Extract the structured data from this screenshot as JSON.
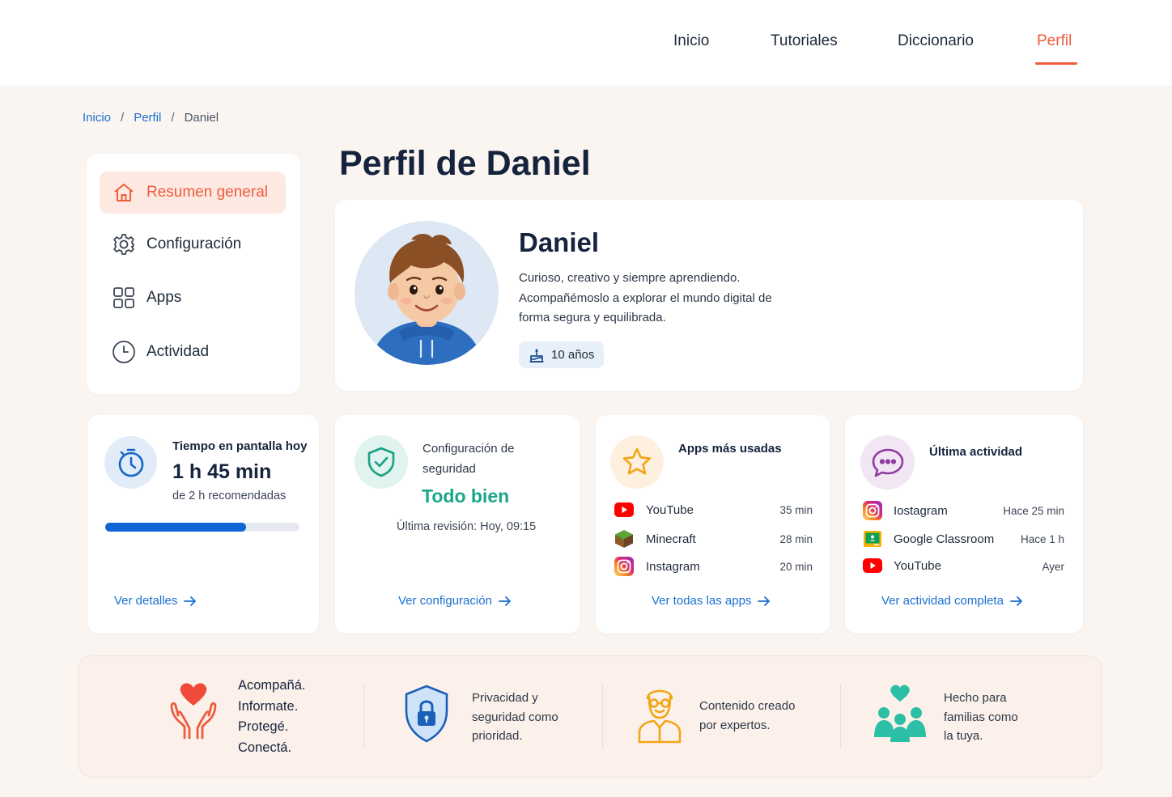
{
  "nav": {
    "items": [
      "Inicio",
      "Tutoriales",
      "Diccionario",
      "Perfil"
    ],
    "active": "Perfil"
  },
  "breadcrumb": [
    "Inicio",
    "Perfil",
    "Daniel"
  ],
  "sidebar": {
    "items": [
      {
        "label": "Resumen general",
        "icon": "home-icon",
        "active": true
      },
      {
        "label": "Configuración",
        "icon": "gear-icon"
      },
      {
        "label": "Apps",
        "icon": "grid-icon"
      },
      {
        "label": "Actividad",
        "icon": "clock-icon"
      }
    ]
  },
  "page_title": "Perfil de Daniel",
  "profile": {
    "name": "Daniel",
    "description": "Curioso, creativo y siempre aprendiendo. Acompañémoslo a explorar el mundo digital de forma segura y equilibrada.",
    "age": "10 años"
  },
  "screen_time": {
    "title": "Tiempo en pantalla hoy",
    "value": "1 h 45 min",
    "subtitle": "de 2 h recomendadas",
    "progress": 0.725,
    "link": "Ver detalles"
  },
  "security": {
    "title": "Configuración de seguridad",
    "status": "Todo bien",
    "last_review": "Última revisión: Hoy, 09:15",
    "link": "Ver configuración"
  },
  "top_apps": {
    "title": "Apps más usadas",
    "apps": [
      {
        "name": "YouTube",
        "time": "35 min",
        "icon": "youtube-icon"
      },
      {
        "name": "Minecraft",
        "time": "28 min",
        "icon": "minecraft-icon"
      },
      {
        "name": "Instagram",
        "time": "20 min",
        "icon": "instagram-icon"
      }
    ],
    "link": "Ver todas las apps"
  },
  "last_activity": {
    "title": "Última actividad",
    "items": [
      {
        "name": "Iostagram",
        "when": "Hace 25 min",
        "icon": "instagram-icon"
      },
      {
        "name": "Google Classroom",
        "when": "Hace 1 h",
        "icon": "google-classroom-icon"
      },
      {
        "name": "YouTube",
        "when": "Ayer",
        "icon": "youtube-icon"
      }
    ],
    "link": "Ver actividad completa"
  },
  "footer": {
    "items": [
      {
        "text_lines": [
          "Acompañá.",
          "Informate.",
          "Protegé.",
          "Conectá."
        ],
        "icon": "heart-hands-icon"
      },
      {
        "text_lines": [
          "Privacidad y",
          "seguridad como",
          "prioridad."
        ],
        "icon": "shield-lock-icon"
      },
      {
        "text_lines": [
          "Contenido creado",
          "por expertos."
        ],
        "icon": "expert-icon"
      },
      {
        "text_lines": [
          "Hecho para",
          "familias como",
          "la tuya."
        ],
        "icon": "family-icon"
      }
    ]
  },
  "colors": {
    "accent": "#ef5b3c",
    "link": "#1a6fd1",
    "success": "#1aa68a",
    "progress": "#1265d6"
  }
}
